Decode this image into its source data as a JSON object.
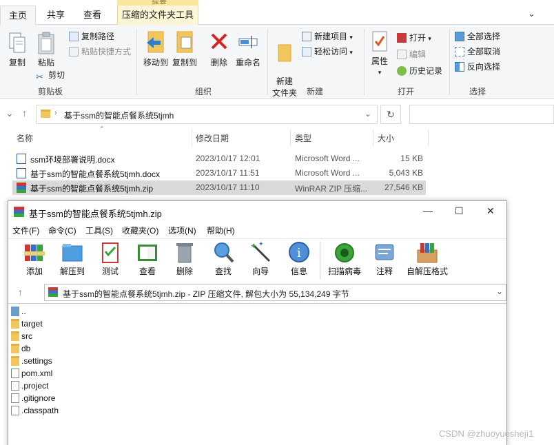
{
  "explorer": {
    "context_header": "提要",
    "tabs": [
      {
        "label": "主页"
      },
      {
        "label": "共享"
      },
      {
        "label": "查看"
      },
      {
        "label": "压缩的文件夹工具"
      }
    ],
    "ribbon": {
      "clipboard": {
        "copy": "复制",
        "paste": "粘贴",
        "copy_path": "复制路径",
        "paste_shortcut": "粘贴快捷方式",
        "cut": "剪切",
        "group": "剪贴板"
      },
      "organize": {
        "move_to": "移动到",
        "copy_to": "复制到",
        "delete": "删除",
        "rename": "重命名",
        "group": "组织"
      },
      "new": {
        "new_folder": "新建\n文件夹",
        "new_item": "新建项目",
        "easy_access": "轻松访问",
        "group": "新建"
      },
      "open": {
        "properties": "属性",
        "open": "打开",
        "edit": "编辑",
        "history": "历史记录",
        "group": "打开"
      },
      "select": {
        "select_all": "全部选择",
        "select_none": "全部取消",
        "invert": "反向选择",
        "group": "选择"
      }
    },
    "address_path": "基于ssm的智能点餐系统5tjmh",
    "columns": {
      "name": "名称",
      "date": "修改日期",
      "type": "类型",
      "size": "大小"
    },
    "files": [
      {
        "name": "ssm环境部署说明.docx",
        "date": "2023/10/17 12:01",
        "type": "Microsoft Word ...",
        "size": "15 KB"
      },
      {
        "name": "基于ssm的智能点餐系统5tjmh.docx",
        "date": "2023/10/17 11:51",
        "type": "Microsoft Word ...",
        "size": "5,043 KB"
      },
      {
        "name": "基于ssm的智能点餐系统5tjmh.zip",
        "date": "2023/10/17 11:10",
        "type": "WinRAR ZIP 压缩...",
        "size": "27,546 KB"
      }
    ]
  },
  "rar": {
    "title": "基于ssm的智能点餐系统5tjmh.zip",
    "menu": [
      "文件(F)",
      "命令(C)",
      "工具(S)",
      "收藏夹(O)",
      "选项(N)",
      "帮助(H)"
    ],
    "toolbar": [
      "添加",
      "解压到",
      "测试",
      "查看",
      "删除",
      "查找",
      "向导",
      "信息",
      "扫描病毒",
      "注释",
      "自解压格式"
    ],
    "address": "基于ssm的智能点餐系统5tjmh.zip - ZIP 压缩文件, 解包大小为 55,134,249 字节",
    "items": [
      {
        "name": "..",
        "kind": "up"
      },
      {
        "name": "target",
        "kind": "folder"
      },
      {
        "name": "src",
        "kind": "folder"
      },
      {
        "name": "db",
        "kind": "folder"
      },
      {
        "name": ".settings",
        "kind": "folder"
      },
      {
        "name": "pom.xml",
        "kind": "xml"
      },
      {
        "name": ".project",
        "kind": "file"
      },
      {
        "name": ".gitignore",
        "kind": "file"
      },
      {
        "name": ".classpath",
        "kind": "file"
      }
    ]
  },
  "watermark": "CSDN @zhuoyueshejì1"
}
